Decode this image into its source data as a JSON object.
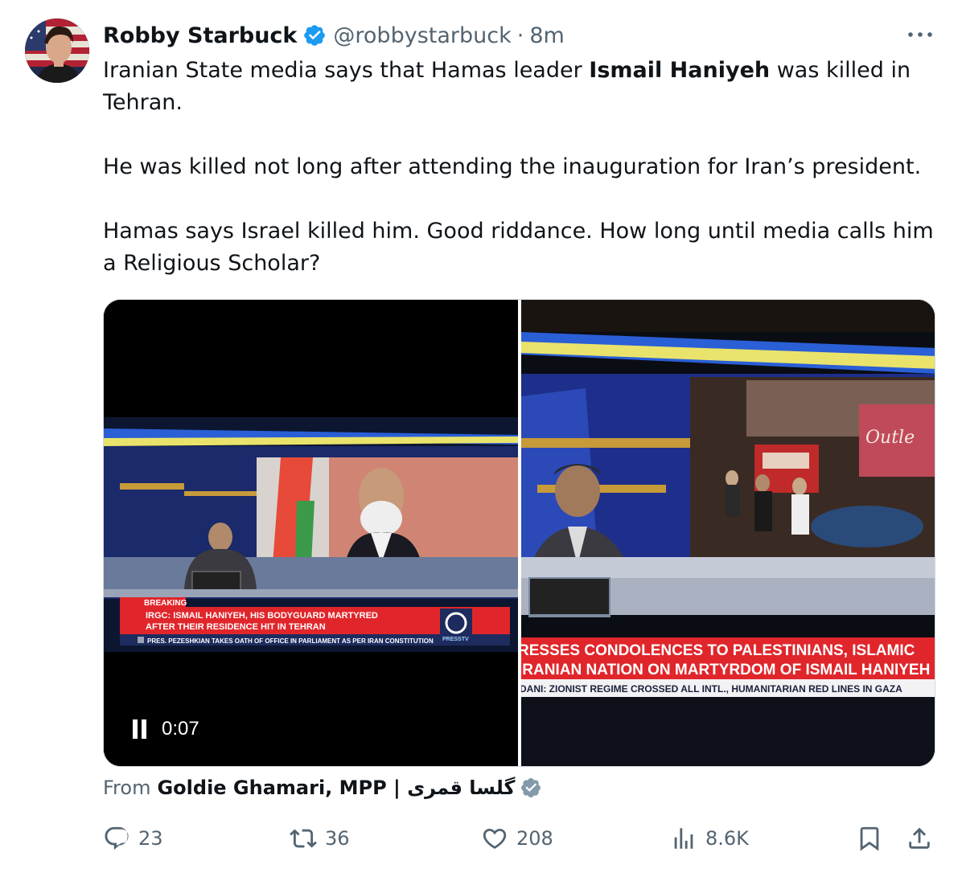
{
  "author": {
    "name": "Robby Starbuck",
    "handle": "@robbystarbuck",
    "separator": "·",
    "time": "8m",
    "avatar_icon": "avatar-photo-american-flag",
    "verified_icon": "verified-badge-icon"
  },
  "more_icon": "more-horizontal-icon",
  "tweet": {
    "para1_before": "Iranian State media says that Hamas leader ",
    "para1_bold": "Ismail Haniyeh",
    "para1_after": " was killed in Tehran.",
    "para2": "He was killed not long after attending the inauguration for Iran’s president.",
    "para3": "Hamas says Israel killed him. Good riddance. How long until media calls him a Religious Scholar?"
  },
  "media": {
    "left": {
      "breaking_label": "BREAKING",
      "headline_line1": "IRGC: ISMAIL HANIYEH, HIS BODYGUARD MARTYRED",
      "headline_line2": "AFTER THEIR RESIDENCE HIT IN TEHRAN",
      "ticker": "PRES. PEZESHKIAN TAKES OATH OF OFFICE IN PARLIAMENT AS PER IRAN CONSTITUTION",
      "channel_logo": "PRESSTV",
      "video_time": "0:07",
      "pause_icon": "pause-icon"
    },
    "right": {
      "headline_line1": "RESSES CONDOLENCES TO PALESTINIANS, ISLAMIC",
      "headline_line2": "IRANIAN NATION ON MARTYRDOM OF ISMAIL HANIYEH",
      "ticker": "DANI: ZIONIST REGIME CROSSED ALL INTL., HUMANITARIAN RED LINES IN GAZA",
      "sign_text": "Outle"
    }
  },
  "source": {
    "prefix": "From",
    "name": "Goldie Ghamari, MPP | گلسا قمری",
    "badge_icon": "grey-verified-badge-icon"
  },
  "actions": {
    "replies": "23",
    "reposts": "36",
    "likes": "208",
    "views": "8.6K",
    "icons": [
      "reply-icon",
      "repost-icon",
      "like-icon",
      "views-icon",
      "bookmark-icon",
      "share-icon"
    ]
  },
  "colors": {
    "text": "#0f1419",
    "secondary": "#536471",
    "verified": "#1d9bf0",
    "breaking_red": "#e0262b"
  }
}
